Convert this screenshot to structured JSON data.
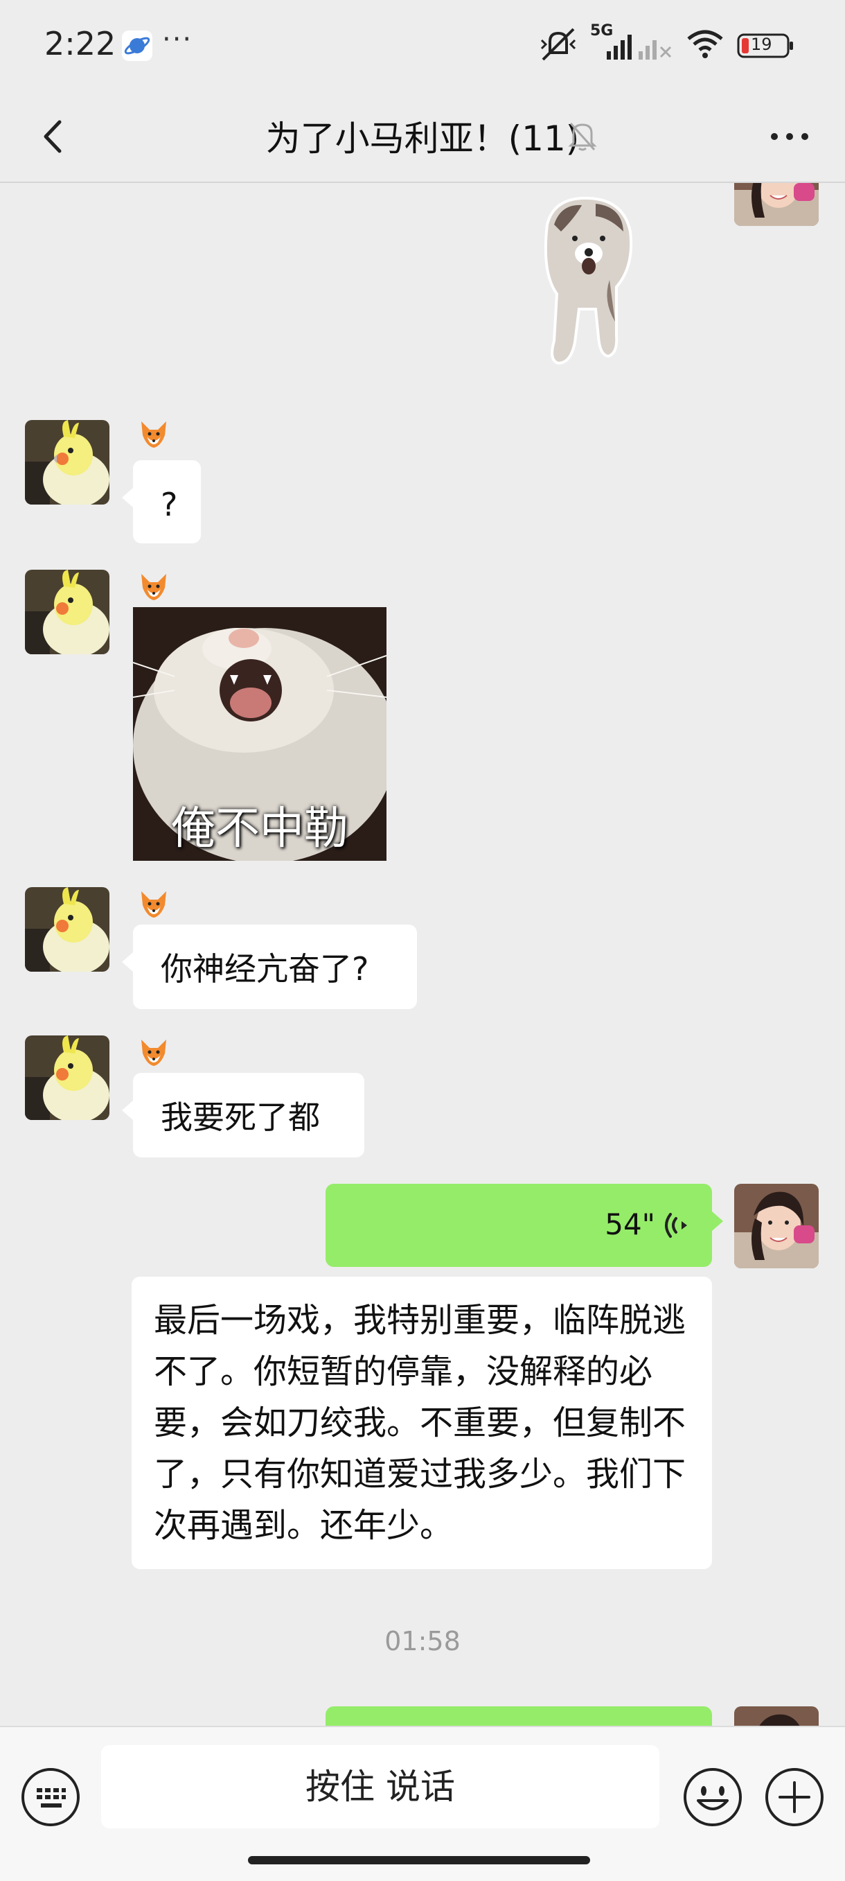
{
  "status_bar": {
    "time": "2:22",
    "dots": "···",
    "network": "5G",
    "battery": "19",
    "icons": [
      "planet-app-icon",
      "mute-vibrate-icon",
      "signal-icon",
      "wifi-icon",
      "battery-icon"
    ]
  },
  "nav": {
    "title": "为了小马利亚！(11)",
    "icons": [
      "back-chevron-icon",
      "bell-muted-icon",
      "more-icon"
    ]
  },
  "messages": [
    {
      "side": "right",
      "type": "sticker",
      "sticker": "dancing-dog-sticker"
    },
    {
      "side": "left",
      "nickname": "🦊",
      "type": "text",
      "text": "?"
    },
    {
      "side": "left",
      "nickname": "🦊",
      "type": "image",
      "caption": "俺不中勒",
      "sticker": "screaming-cat-meme"
    },
    {
      "side": "left",
      "nickname": "🦊",
      "type": "text",
      "text": "你神经亢奋了?"
    },
    {
      "side": "left",
      "nickname": "🦊",
      "type": "text",
      "text": "我要死了都"
    },
    {
      "side": "right",
      "type": "voice",
      "duration": "54\"",
      "transcript": "最后一场戏，我特别重要，临阵脱逃不了。你短暂的停靠，没解释的必要，会如刀绞我。不重要，但复制不了，只有你知道爱过我多少。我们下次再遇到。还年少。"
    }
  ],
  "timestamp": "01:58",
  "input_bar": {
    "talk_label": "按住 说话",
    "icons": [
      "keyboard-icon",
      "emoji-icon",
      "plus-icon"
    ]
  },
  "colors": {
    "background": "#ededed",
    "sent_bubble": "#95ec69",
    "received_bubble": "#ffffff",
    "battery_low": "#e53935"
  }
}
